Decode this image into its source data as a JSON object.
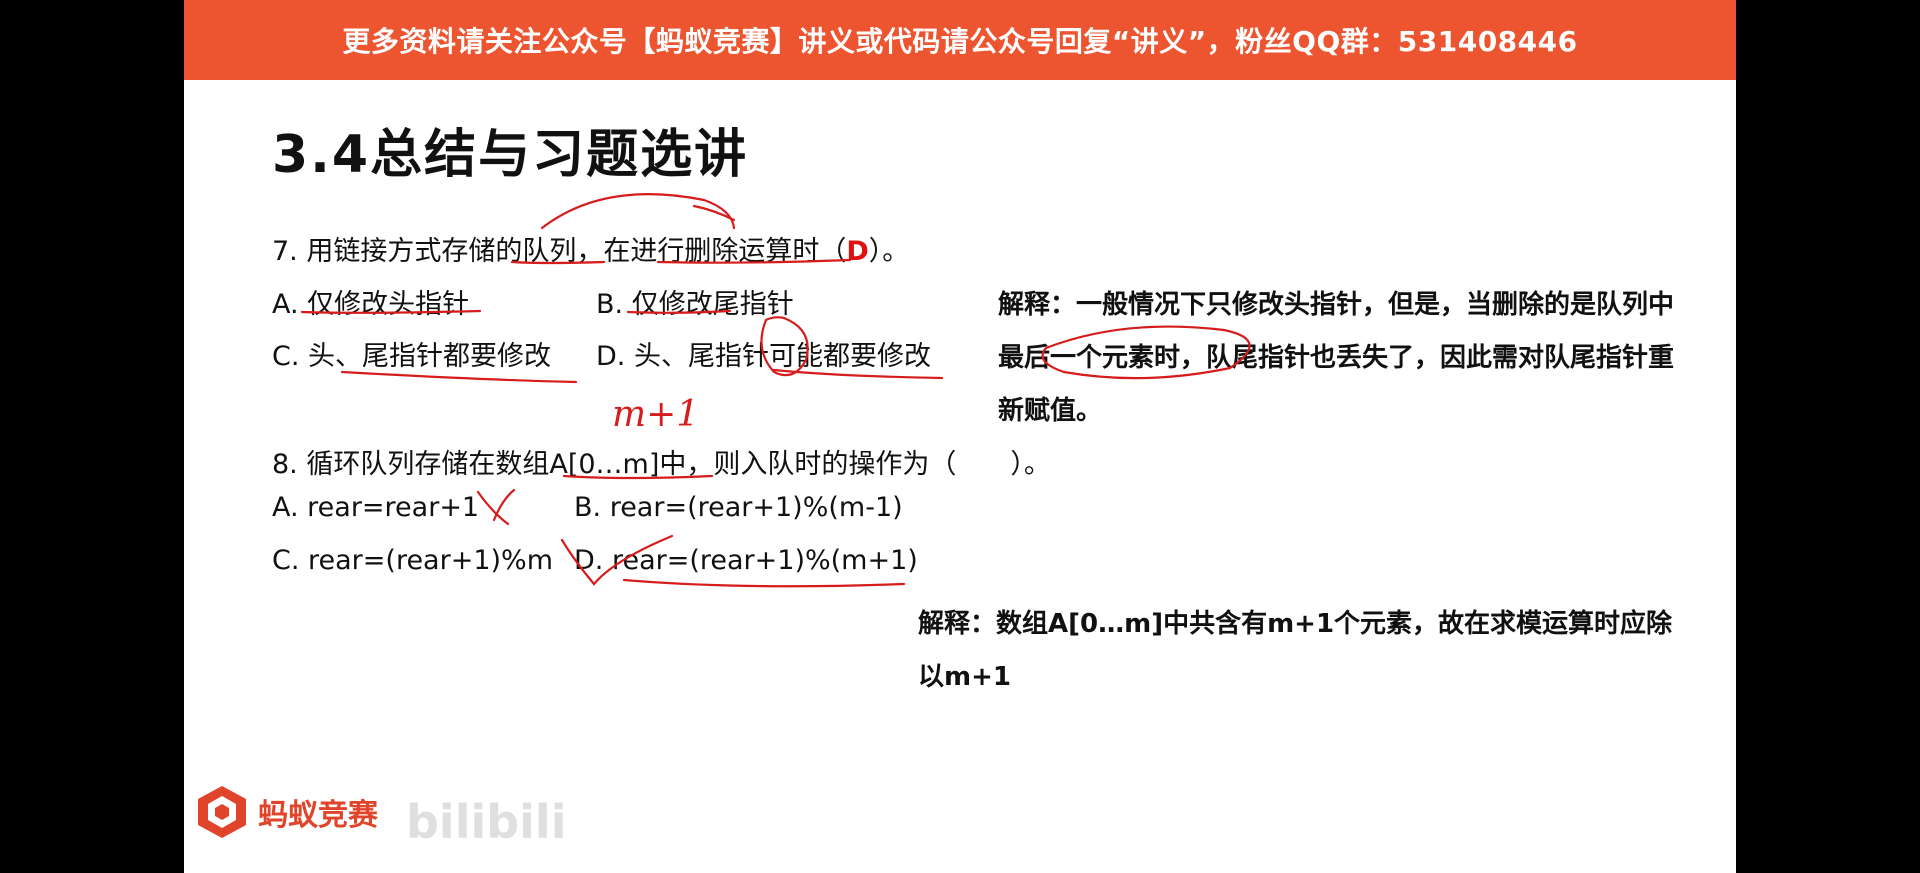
{
  "banner": "更多资料请关注公众号【蚂蚁竞赛】讲义或代码请公众号回复“讲义”，粉丝QQ群：531408446",
  "title": "3.4总结与习题选讲",
  "q7": {
    "stem_pre": "7. 用链接方式存储的队列，在进行删除运算时（",
    "answer": "D",
    "stem_post": "）。",
    "optA": "A. 仅修改头指针",
    "optB": "B. 仅修改尾指针",
    "optC": "C. 头、尾指针都要修改",
    "optD": "D. 头、尾指针可能都要修改",
    "explanation": "解释：一般情况下只修改头指针，但是，当删除的是队列中最后一个元素时，队尾指针也丢失了，因此需对队尾指针重新赋值。"
  },
  "q8": {
    "handwritten_note": "m+1",
    "stem": "8. 循环队列存储在数组A[0…m]中，则入队时的操作为（　　）。",
    "optA": "A. rear=rear+1",
    "optB": "B. rear=(rear+1)%(m-1)",
    "optC": "C. rear=(rear+1)%m",
    "optD": "D. rear=(rear+1)%(m+1)",
    "explanation": "解释：数组A[0…m]中共含有m+1个元素，故在求模运算时应除以m+1"
  },
  "logo": {
    "text": "蚂蚁竞赛",
    "watermark": "bilibili"
  },
  "colors": {
    "banner": "#ed5530",
    "ink": "#d61c1c",
    "answer": "#e01010"
  }
}
